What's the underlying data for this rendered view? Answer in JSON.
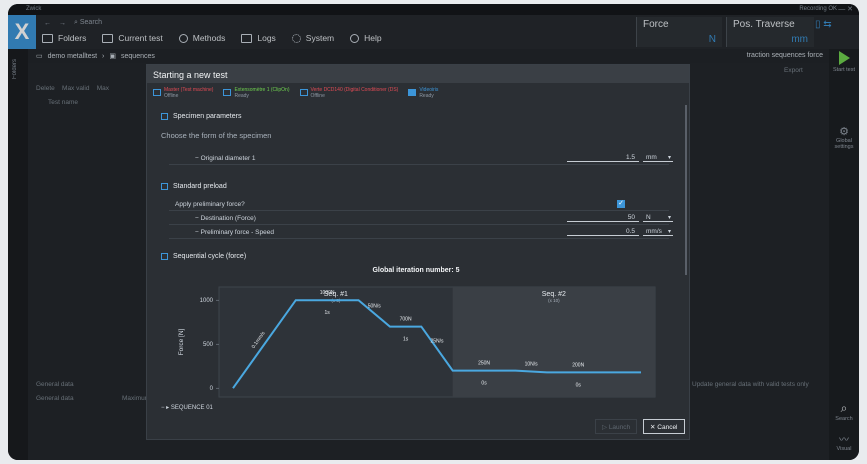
{
  "app": {
    "title": "Zwick",
    "recording": "Recording OK"
  },
  "search": {
    "placeholder": "Search"
  },
  "nav_tabs": [
    {
      "label": "Folders",
      "icon": "folder-icon"
    },
    {
      "label": "Current test",
      "icon": "chart-icon"
    },
    {
      "label": "Methods",
      "icon": "flask-icon"
    },
    {
      "label": "Logs",
      "icon": "list-icon"
    },
    {
      "label": "System",
      "icon": "gear-icon"
    },
    {
      "label": "Help",
      "icon": "help-icon"
    }
  ],
  "readouts": [
    {
      "label": "Force",
      "unit": "N"
    },
    {
      "label": "Pos. Traverse",
      "unit": "mm"
    }
  ],
  "breadcrumb": {
    "folder": "demo metalltest",
    "item": "sequences",
    "right": "traction sequences force"
  },
  "background": {
    "toolbar_labels": [
      "Delete",
      "Max valid",
      "Max"
    ],
    "column_test_name": "Test name",
    "general_data_label": "General data",
    "general_data_col": "General data",
    "general_data_col2": "Maximum",
    "update_general_data": "Update general data with valid tests only",
    "export": "Export"
  },
  "right_sidebar": {
    "start_test": "Start test",
    "global_settings": "Global settings",
    "search": "Search",
    "visual": "Visual"
  },
  "modal": {
    "title": "Starting a new test",
    "devices": [
      {
        "name": "Master (Test machine)",
        "status": "Offline",
        "color": "red"
      },
      {
        "name": "Extensomètre 1 (ClipOn)",
        "status": "Ready",
        "color": "green"
      },
      {
        "name": "Verte DCD140 (Digital Conditioner (DS)",
        "status": "Offline",
        "color": "red"
      },
      {
        "name": "Videoiris",
        "status": "Ready",
        "color": "blue"
      }
    ],
    "specimen": {
      "title": "Specimen parameters",
      "hint": "Choose the form of the specimen",
      "diameter_label": "Original diameter 1",
      "diameter_value": "1.5",
      "diameter_unit": "mm"
    },
    "preload": {
      "title": "Standard preload",
      "apply_label": "Apply preliminary force?",
      "apply_checked": true,
      "destination_label": "Destination (Force)",
      "destination_value": "50",
      "destination_unit": "N",
      "speed_label": "Preliminary force - Speed",
      "speed_value": "0.5",
      "speed_unit": "mm/s"
    },
    "cycle": {
      "title": "Sequential cycle (force)"
    },
    "sequence_fold": "SEQUENCE 01",
    "buttons": {
      "launch": "Launch",
      "cancel": "Cancel"
    }
  },
  "chart_data": {
    "type": "line",
    "title": "Global iteration number: 5",
    "ylabel": "Force [N]",
    "xlabel": "",
    "ylim": [
      -100,
      1150
    ],
    "yticks": [
      0,
      500,
      1000
    ],
    "grid": false,
    "x": [
      0,
      2,
      4,
      5,
      6,
      7,
      8,
      9,
      10,
      11,
      12,
      13
    ],
    "values": [
      0,
      1000,
      1000,
      700,
      700,
      200,
      200,
      200,
      180,
      180,
      180,
      180
    ],
    "sequences": [
      {
        "name": "Seq. #1",
        "repeat": "(x 3)"
      },
      {
        "name": "Seq. #2",
        "repeat": "(x 10)"
      }
    ],
    "annotations": [
      "0.1mm/s",
      "1000N",
      "1s",
      "50N/s",
      "700N",
      "1s",
      "25N/s",
      "250N",
      "0s",
      "10N/s",
      "200N",
      "0s"
    ],
    "line_color": "#4aa8e0"
  }
}
